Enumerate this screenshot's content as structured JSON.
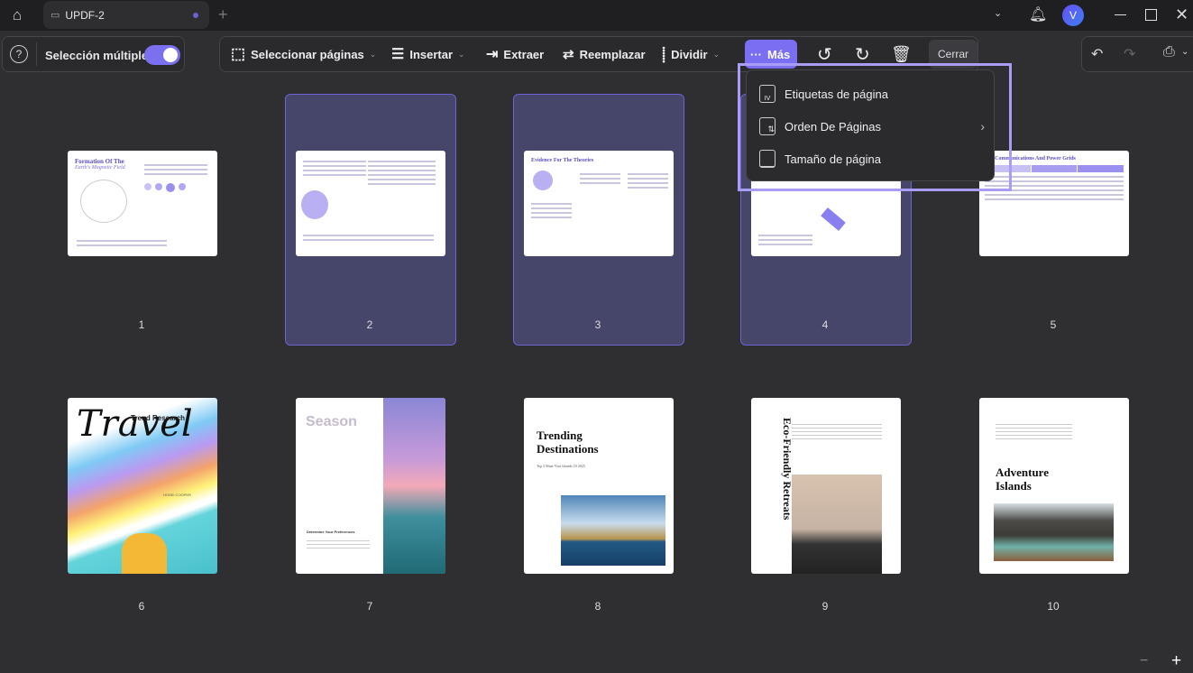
{
  "titlebar": {
    "tab_title": "UPDF-2",
    "avatar_letter": "V"
  },
  "toolbar": {
    "help_label": "?",
    "multi_select_label": "Selección múltiple",
    "multi_select_on": true,
    "select_pages": "Seleccionar páginas",
    "insert": "Insertar",
    "extract": "Extraer",
    "replace": "Reemplazar",
    "split": "Dividir",
    "more": "Más",
    "close": "Cerrar"
  },
  "more_menu": {
    "items": [
      {
        "label": "Etiquetas de página",
        "icon": "page-label-icon"
      },
      {
        "label": "Orden De Páginas",
        "icon": "page-order-icon",
        "submenu": true
      },
      {
        "label": "Tamaño de página",
        "icon": "page-size-icon"
      }
    ]
  },
  "pages": [
    {
      "number": "1",
      "title": "Formation Of The",
      "subtitle": "Earth's Magnetic Field",
      "selected": false
    },
    {
      "number": "2",
      "title": "",
      "selected": true
    },
    {
      "number": "3",
      "title": "Evidence For The Theories",
      "selected": true
    },
    {
      "number": "4",
      "title": "",
      "selected": true
    },
    {
      "number": "5",
      "title": "llite Communications And Power Grids",
      "selected": false
    },
    {
      "number": "6",
      "title": "Travel",
      "subtitle": "Trend Research",
      "author": "HOSEI COOPER",
      "selected": false
    },
    {
      "number": "7",
      "title": "Season",
      "subtitle": "Determine Your Preferences",
      "selected": false
    },
    {
      "number": "8",
      "title": "Trending Destinations",
      "subtitle": "Top 5 Must-Visit Islands Of 2025",
      "selected": false
    },
    {
      "number": "9",
      "title": "Eco-Friendly Retreats",
      "selected": false
    },
    {
      "number": "10",
      "title": "Adventure Islands",
      "selected": false
    }
  ],
  "colors": {
    "accent": "#7a6ef2",
    "selection": "#46456a",
    "highlight": "#a89cf4"
  },
  "zoom": {
    "minus": "−",
    "plus": "+"
  }
}
